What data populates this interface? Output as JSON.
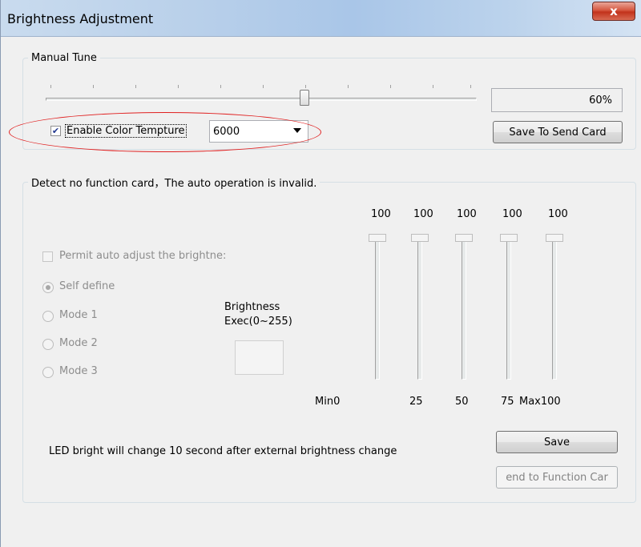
{
  "window": {
    "title": "Brightness Adjustment",
    "close_glyph": "x"
  },
  "manual_tune": {
    "legend": "Manual Tune",
    "slider_value_fraction": 0.6,
    "percent_text": "60%",
    "enable_color_label": "Enable Color Tempture",
    "enable_color_checked": true,
    "color_temp_value": "6000",
    "save_to_send_card_label": "Save To Send Card"
  },
  "auto": {
    "legend": "Detect no function card，The auto operation is invalid.",
    "permit_label": "Permit auto adjust the brightne:",
    "radios": [
      {
        "label": "Self define",
        "selected": true
      },
      {
        "label": "Mode 1",
        "selected": false
      },
      {
        "label": "Mode 2",
        "selected": false
      },
      {
        "label": "Mode 3",
        "selected": false
      }
    ],
    "brightness_label": "Brightness",
    "exec_label": "Exec(0~255)",
    "slider_values": [
      "100",
      "100",
      "100",
      "100",
      "100"
    ],
    "bottom_labels": [
      "Min0",
      "25",
      "50",
      "75",
      "Max100"
    ],
    "note": "LED bright will change 10 second after external brightness change",
    "save_label": "Save",
    "send_to_function_card_label": "end to Function Car"
  },
  "colors": {
    "highlight_ellipse": "#e02020",
    "close_button": "#c2321b"
  }
}
